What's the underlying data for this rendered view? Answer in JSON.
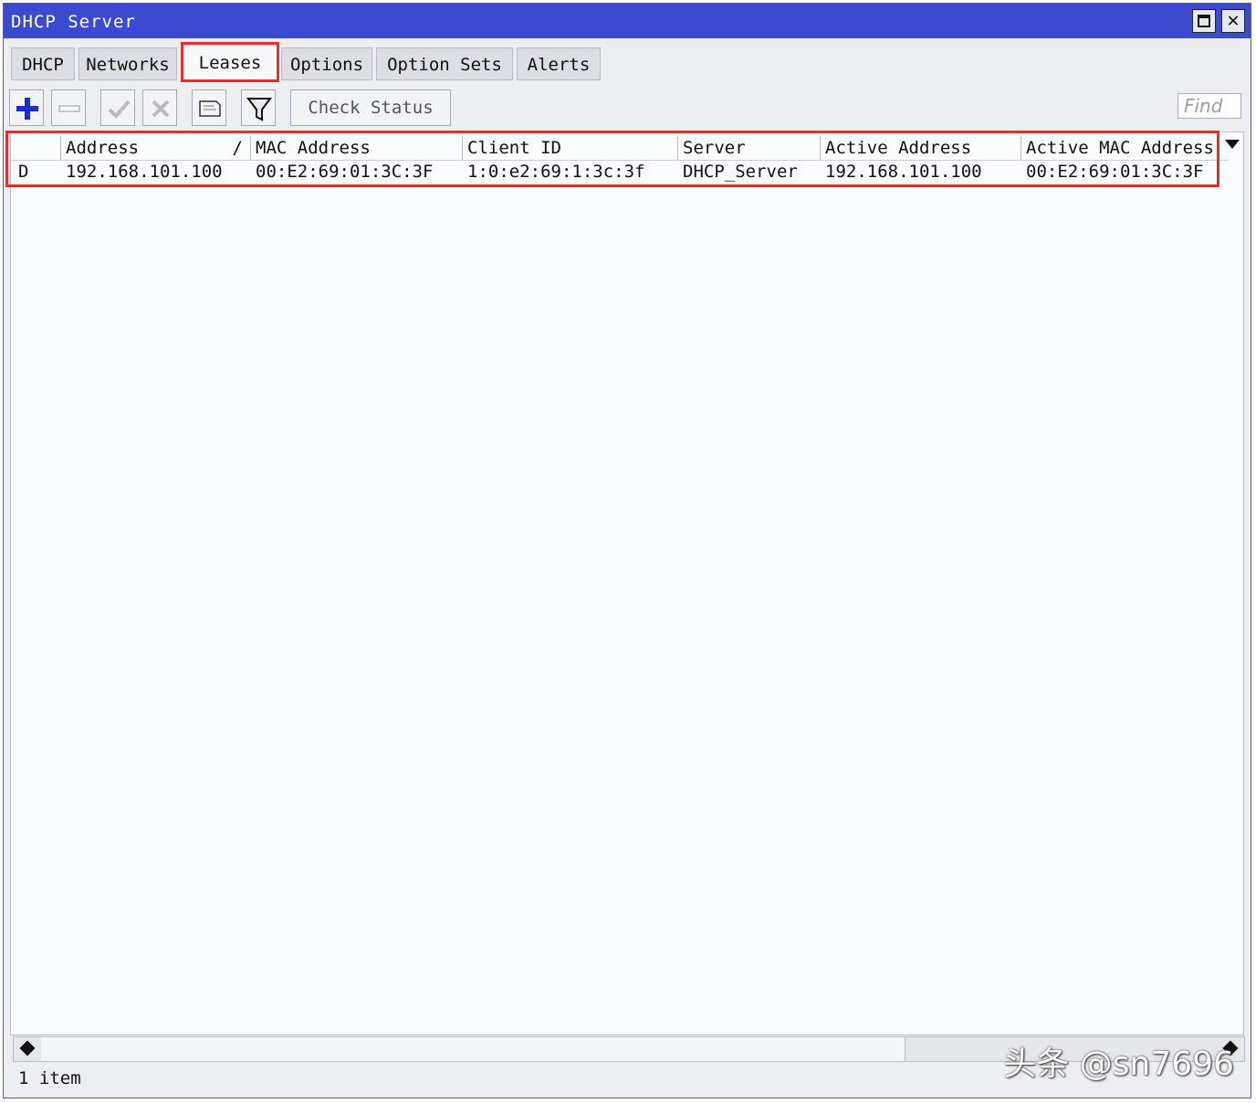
{
  "window": {
    "title": "DHCP Server"
  },
  "tabs": [
    {
      "label": "DHCP"
    },
    {
      "label": "Networks"
    },
    {
      "label": "Leases"
    },
    {
      "label": "Options"
    },
    {
      "label": "Option Sets"
    },
    {
      "label": "Alerts"
    }
  ],
  "active_tab": "Leases",
  "toolbar": {
    "check_status_label": "Check Status",
    "find_placeholder": "Find",
    "icons": [
      "add-icon",
      "remove-icon",
      "enable-icon",
      "disable-icon",
      "comment-icon",
      "filter-icon"
    ]
  },
  "table": {
    "columns": [
      "Address",
      "MAC Address",
      "Client ID",
      "Server",
      "Active Address",
      "Active MAC Address"
    ],
    "sort_indicator": "/",
    "rows": [
      {
        "flag": "D",
        "address": "192.168.101.100",
        "mac_address": "00:E2:69:01:3C:3F",
        "client_id": "1:0:e2:69:1:3c:3f",
        "server": "DHCP_Server",
        "active_address": "192.168.101.100",
        "active_mac_address": "00:E2:69:01:3C:3F"
      }
    ]
  },
  "status": {
    "count_text": "1 item"
  },
  "watermark": "头条 @sn7696",
  "colors": {
    "titlebar": "#3c4ad0",
    "highlight": "#e03030",
    "add_icon": "#1a2fc8"
  }
}
